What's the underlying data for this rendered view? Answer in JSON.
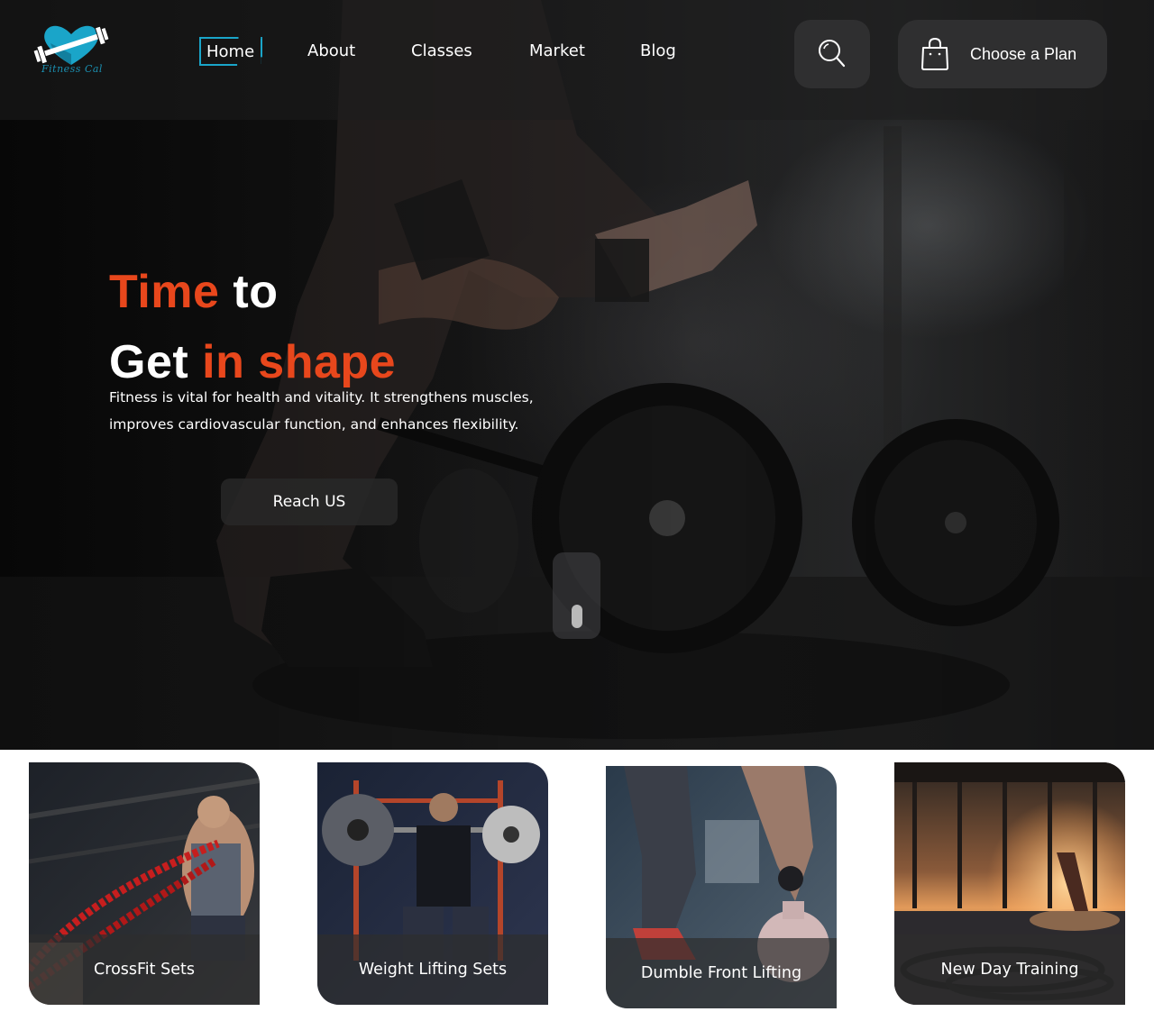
{
  "brand": {
    "name": "Fitness Cal"
  },
  "nav": {
    "items": [
      {
        "label": "Home",
        "active": true
      },
      {
        "label": "About"
      },
      {
        "label": "Classes"
      },
      {
        "label": "Market"
      },
      {
        "label": "Blog"
      }
    ],
    "search_icon": "search-icon",
    "plan_button": {
      "label": "Choose a Plan",
      "icon": "shopping-bag-icon"
    }
  },
  "hero": {
    "line1_accent": "Time",
    "line1_rest": " to",
    "line2_start": "Get ",
    "line2_accent": "in shape",
    "description_line1": "Fitness is vital for health and vitality. It strengthens muscles,",
    "description_line2": "improves cardiovascular function, and enhances flexibility.",
    "cta_label": "Reach US"
  },
  "cards": [
    {
      "label": "CrossFit Sets"
    },
    {
      "label": "Weight Lifting Sets"
    },
    {
      "label": "Dumble Front Lifting"
    },
    {
      "label": "New Day Training"
    }
  ],
  "colors": {
    "accent": "#e8471c",
    "brand": "#1aa5c9",
    "button_bg": "#2f2f30"
  }
}
